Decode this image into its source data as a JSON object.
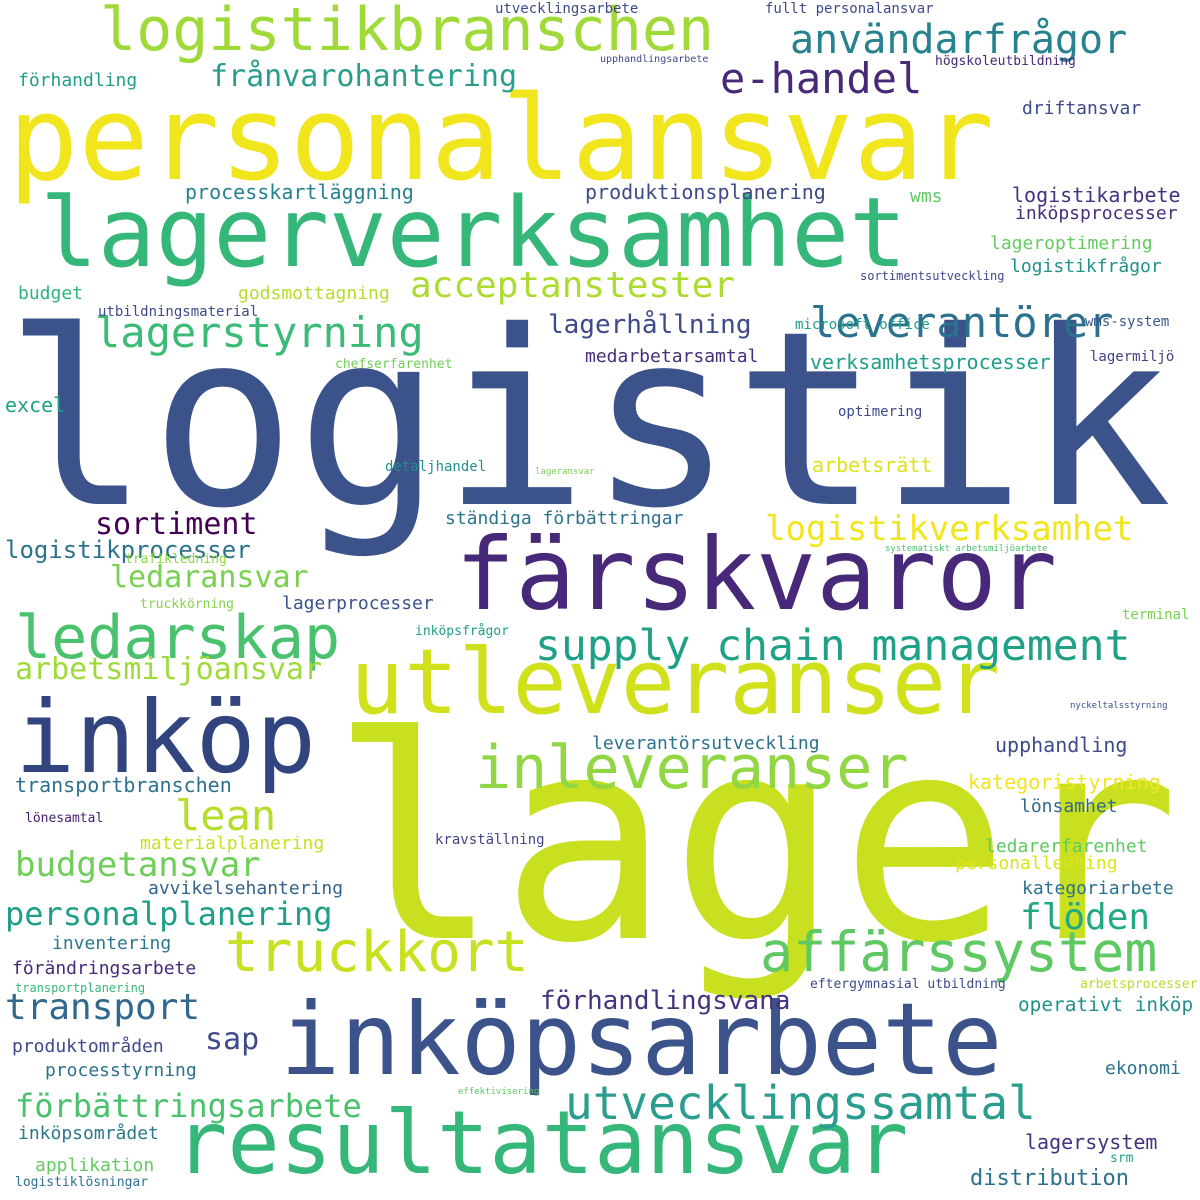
{
  "words": [
    {
      "text": "logistik",
      "color": "#3b528b"
    },
    {
      "text": "lager",
      "color": "#c8e020"
    },
    {
      "text": "personalansvar",
      "color": "#f1e51d"
    },
    {
      "text": "lagerverksamhet",
      "color": "#35b779"
    },
    {
      "text": "färskvaror",
      "color": "#482878"
    },
    {
      "text": "utleveranser",
      "color": "#d0e11c"
    },
    {
      "text": "inköpsarbete",
      "color": "#3b528b"
    },
    {
      "text": "resultatansvar",
      "color": "#35b779"
    },
    {
      "text": "inköp",
      "color": "#31447e"
    },
    {
      "text": "logistikbranschen",
      "color": "#a0da39"
    },
    {
      "text": "inleveranser",
      "color": "#90d743"
    },
    {
      "text": "ledarskap",
      "color": "#4ac16d"
    },
    {
      "text": "truckkort",
      "color": "#c8e020"
    },
    {
      "text": "affärssystem",
      "color": "#5ec962"
    },
    {
      "text": "utvecklingssamtal",
      "color": "#2a9d8e"
    },
    {
      "text": "supply chain management",
      "color": "#1fa187"
    },
    {
      "text": "användarfrågor",
      "color": "#26828e"
    },
    {
      "text": "e-handel",
      "color": "#482878"
    },
    {
      "text": "lagerstyrning",
      "color": "#3bbb75"
    },
    {
      "text": "leverantörer",
      "color": "#2c728e"
    },
    {
      "text": "acceptanstester",
      "color": "#addc30"
    },
    {
      "text": "frånvarohantering",
      "color": "#2a9d8e"
    },
    {
      "text": "logistikverksamhet",
      "color": "#f1e51d"
    },
    {
      "text": "lean",
      "color": "#b5de2b"
    },
    {
      "text": "budgetansvar",
      "color": "#6ece58"
    },
    {
      "text": "personalplanering",
      "color": "#1f9e89"
    },
    {
      "text": "förbättringsarbete",
      "color": "#4ac16d"
    },
    {
      "text": "sortiment",
      "color": "#440154"
    },
    {
      "text": "ledaransvar",
      "color": "#7ad151"
    },
    {
      "text": "arbetsmiljöansvar",
      "color": "#9fda3a"
    },
    {
      "text": "transport",
      "color": "#31688e"
    },
    {
      "text": "flöden",
      "color": "#22a884"
    },
    {
      "text": "lagerhållning",
      "color": "#3e4a89"
    },
    {
      "text": "förhandlingsvana",
      "color": "#46327e"
    },
    {
      "text": "sap",
      "color": "#3e4a89"
    },
    {
      "text": "logistikprocesser",
      "color": "#2c728e"
    },
    {
      "text": "processkartläggning",
      "color": "#26828e"
    },
    {
      "text": "produktionsplanering",
      "color": "#3e4a89"
    },
    {
      "text": "logistikarbete",
      "color": "#46327e"
    },
    {
      "text": "inköpsprocesser",
      "color": "#472d7b"
    },
    {
      "text": "lageroptimering",
      "color": "#63cb5f"
    },
    {
      "text": "logistikfrågor",
      "color": "#21918c"
    },
    {
      "text": "wms",
      "color": "#5ec962"
    },
    {
      "text": "budget",
      "color": "#2eb37c"
    },
    {
      "text": "godsmottagning",
      "color": "#b5de2b"
    },
    {
      "text": "utbildningsmaterial",
      "color": "#3e4a89"
    },
    {
      "text": "microsoft office",
      "color": "#1f9e89"
    },
    {
      "text": "wms-system",
      "color": "#38588c"
    },
    {
      "text": "medarbetarsamtal",
      "color": "#472d7b"
    },
    {
      "text": "verksamhetsprocesser",
      "color": "#1f9e89"
    },
    {
      "text": "chefserfarenhet",
      "color": "#6ece58"
    },
    {
      "text": "lagermiljö",
      "color": "#424086"
    },
    {
      "text": "excel",
      "color": "#1fa187"
    },
    {
      "text": "optimering",
      "color": "#3e4a89"
    },
    {
      "text": "detaljhandel",
      "color": "#21918c"
    },
    {
      "text": "lageransvar",
      "color": "#7ad151"
    },
    {
      "text": "arbetsrätt",
      "color": "#dde318"
    },
    {
      "text": "ständiga förbättringar",
      "color": "#2c728e"
    },
    {
      "text": "systematiskt arbetsmiljöarbete",
      "color": "#4ac16d"
    },
    {
      "text": "trafikledning",
      "color": "#90d743"
    },
    {
      "text": "lagerprocesser",
      "color": "#3b528b"
    },
    {
      "text": "truckkörning",
      "color": "#86d549"
    },
    {
      "text": "inköpsfrågor",
      "color": "#1f9e89"
    },
    {
      "text": "terminal",
      "color": "#7ad151"
    },
    {
      "text": "nyckeltalsstyrning",
      "color": "#3b528b"
    },
    {
      "text": "leverantörsutveckling",
      "color": "#2c728e"
    },
    {
      "text": "upphandling",
      "color": "#3e4a89"
    },
    {
      "text": "kategoristyrning",
      "color": "#f1e51d"
    },
    {
      "text": "transportbranschen",
      "color": "#2c728e"
    },
    {
      "text": "lönsamhet",
      "color": "#31688e"
    },
    {
      "text": "lönesamtal",
      "color": "#481f70"
    },
    {
      "text": "materialplanering",
      "color": "#c8e020"
    },
    {
      "text": "kravställning",
      "color": "#414487"
    },
    {
      "text": "ledarerfarenhet",
      "color": "#5ec962"
    },
    {
      "text": "personalledning",
      "color": "#dde318"
    },
    {
      "text": "avvikelsehantering",
      "color": "#33638d"
    },
    {
      "text": "kategoriarbete",
      "color": "#2c728e"
    },
    {
      "text": "inventering",
      "color": "#2a788e"
    },
    {
      "text": "förändringsarbete",
      "color": "#482878"
    },
    {
      "text": "transportplanering",
      "color": "#35b779"
    },
    {
      "text": "eftergymnasial utbildning",
      "color": "#3e4a89"
    },
    {
      "text": "arbetsprocesser",
      "color": "#b5de2b"
    },
    {
      "text": "operativt inköp",
      "color": "#21918c"
    },
    {
      "text": "produktområden",
      "color": "#3e4a89"
    },
    {
      "text": "processtyrning",
      "color": "#2c728e"
    },
    {
      "text": "effektivisering",
      "color": "#5ec962"
    },
    {
      "text": "ekonomi",
      "color": "#2c728e"
    },
    {
      "text": "inköpsområdet",
      "color": "#2a788e"
    },
    {
      "text": "lagersystem",
      "color": "#46327e"
    },
    {
      "text": "applikation",
      "color": "#63cb5f"
    },
    {
      "text": "srm",
      "color": "#1fa187"
    },
    {
      "text": "distribution",
      "color": "#2c728e"
    },
    {
      "text": "logistiklösningar",
      "color": "#2c728e"
    },
    {
      "text": "förhandling",
      "color": "#1f9e89"
    },
    {
      "text": "utvecklingsarbete",
      "color": "#3e4a89"
    },
    {
      "text": "fullt personalansvar",
      "color": "#3e4a89"
    },
    {
      "text": "upphandlingsarbete",
      "color": "#3e4a89"
    },
    {
      "text": "högskoleutbildning",
      "color": "#482878"
    },
    {
      "text": "driftansvar",
      "color": "#3e4a89"
    },
    {
      "text": "sortimentsutveckling",
      "color": "#3e4a89"
    }
  ]
}
